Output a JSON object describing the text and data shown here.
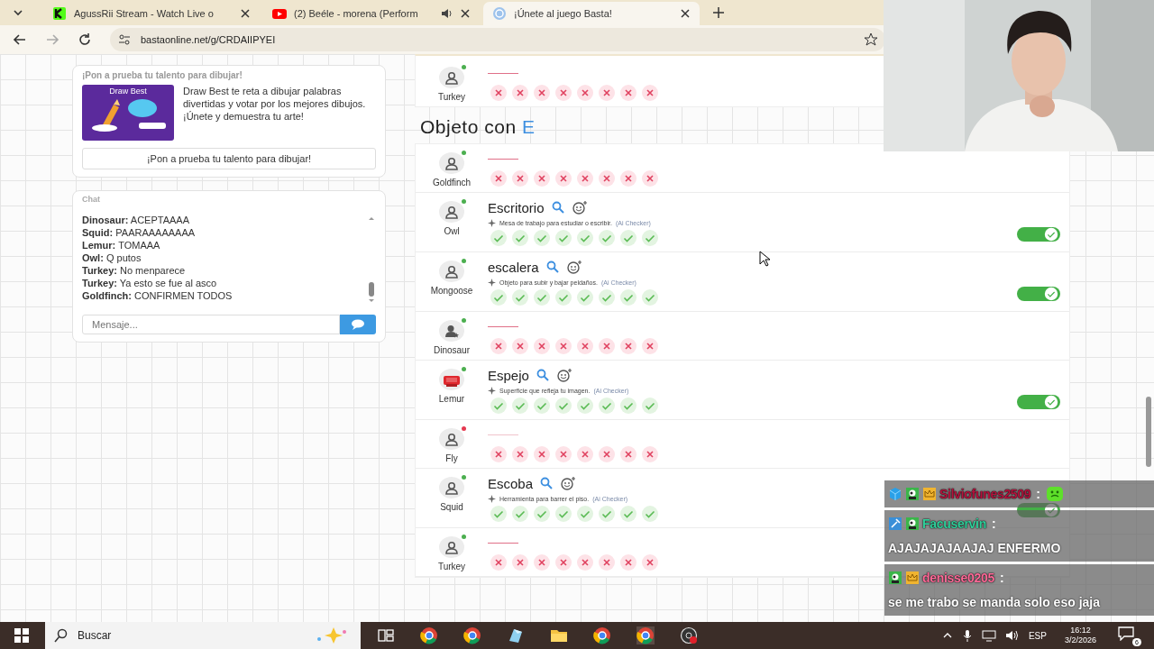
{
  "browser": {
    "tabs": [
      {
        "title": "AgussRii Stream - Watch Live o",
        "kind": "stream",
        "audio": false,
        "selected": false
      },
      {
        "title": "(2) Beéle - morena (Perform",
        "kind": "video",
        "audio": true,
        "selected": false
      },
      {
        "title": "¡Únete al juego Basta!",
        "kind": "game",
        "audio": false,
        "selected": true
      }
    ],
    "url": "bastaonline.net/g/CRDAIIPYEI"
  },
  "ad": {
    "heading": "¡Pon a prueba tu talento para dibujar!",
    "image_title": "Draw Best",
    "description": "Draw Best te reta a dibujar palabras divertidas y votar por los mejores dibujos. ¡Únete y demuestra tu arte!",
    "button": "¡Pon a prueba tu talento para dibujar!"
  },
  "chat": {
    "title": "Chat",
    "messages": [
      {
        "user": "Dinosaur:",
        "text": "ACEPTAAAA"
      },
      {
        "user": "Squid:",
        "text": "PAARAAAAAAAA"
      },
      {
        "user": "Lemur:",
        "text": "TOMAAA"
      },
      {
        "user": "Owl:",
        "text": "Q putos"
      },
      {
        "user": "Turkey:",
        "text": "No menparece"
      },
      {
        "user": "Turkey:",
        "text": "Ya esto se fue al asco"
      },
      {
        "user": "Goldfinch:",
        "text": "CONFIRMEN TODOS"
      }
    ],
    "placeholder": "Mensaje..."
  },
  "results": {
    "previous_rows": [
      {
        "player": "Turkey",
        "online": true,
        "kind": "person",
        "votes": [
          false,
          false,
          false,
          false,
          false,
          false,
          false,
          false
        ]
      }
    ],
    "section": {
      "prefix": "Objeto con",
      "letter": "E"
    },
    "rows": [
      {
        "player": "Goldfinch",
        "online": true,
        "kind": "person",
        "votes": [
          false,
          false,
          false,
          false,
          false,
          false,
          false,
          false
        ]
      },
      {
        "player": "Owl",
        "online": true,
        "kind": "person",
        "answer": "Escritorio",
        "hint": "Mesa de trabajo para estudiar o escribir.",
        "source": "(Ai Checker)",
        "votes": [
          true,
          true,
          true,
          true,
          true,
          true,
          true,
          true
        ],
        "on": true
      },
      {
        "player": "Mongoose",
        "online": true,
        "kind": "person",
        "answer": "escalera",
        "hint": "Objeto para subir y bajar peldaños.",
        "source": "(Ai Checker)",
        "votes": [
          true,
          true,
          true,
          true,
          true,
          true,
          true,
          true
        ],
        "on": true
      },
      {
        "player": "Dinosaur",
        "online": true,
        "kind": "star",
        "votes": [
          false,
          false,
          false,
          false,
          false,
          false,
          false,
          false
        ]
      },
      {
        "player": "Lemur",
        "online": true,
        "kind": "stop",
        "answer": "Espejo",
        "hint": "Superficie que refleja tu imagen.",
        "source": "(Ai Checker)",
        "votes": [
          true,
          true,
          true,
          true,
          true,
          true,
          true,
          true
        ],
        "on": true
      },
      {
        "player": "Fly",
        "online": false,
        "kind": "person",
        "votes": [
          false,
          false,
          false,
          false,
          false,
          false,
          false,
          false
        ]
      },
      {
        "player": "Squid",
        "online": true,
        "kind": "person",
        "answer": "Escoba",
        "hint": "Herramienta para barrer el piso.",
        "source": "(Ai Checker)",
        "votes": [
          true,
          true,
          true,
          true,
          true,
          true,
          true,
          true
        ],
        "on": true
      },
      {
        "player": "Turkey",
        "online": true,
        "kind": "person",
        "votes": [
          false,
          false,
          false,
          false,
          false,
          false,
          false,
          false
        ]
      }
    ]
  },
  "stream_chat": [
    {
      "user": "Silviofunes2509",
      "color": "#b3123c",
      "separator": ":",
      "emote": true
    },
    {
      "user": "Facuservin",
      "color": "#2fcf9a",
      "separator": ":",
      "text": "AJAJAJAJAAJAJ ENFERMO"
    },
    {
      "user": "denisse0205",
      "color": "#ff6a98",
      "separator": ":",
      "text": "se me trabo se manda solo eso jaja"
    }
  ],
  "taskbar": {
    "search": "Buscar",
    "language": "ESP",
    "time": "16:12",
    "date": "3/2/2026",
    "notifications": "6"
  }
}
